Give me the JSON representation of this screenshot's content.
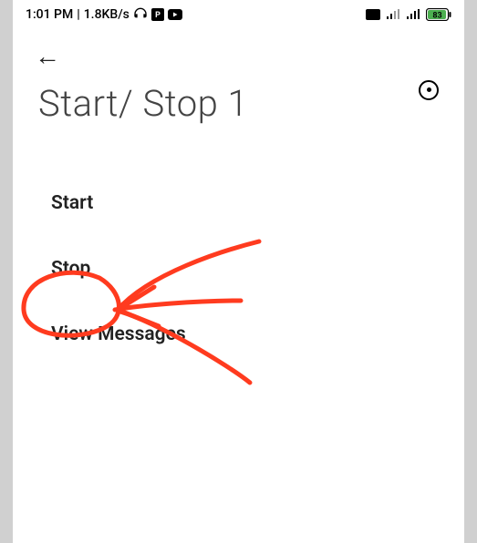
{
  "status": {
    "time": "1:01 PM",
    "speed": "1.8KB/s",
    "battery": "83"
  },
  "header": {
    "title": "Start/ Stop 1"
  },
  "menu": {
    "items": [
      {
        "label": "Start"
      },
      {
        "label": "Stop"
      },
      {
        "label": "View Messages"
      }
    ]
  },
  "annotation": {
    "color": "#ff3b1f"
  }
}
